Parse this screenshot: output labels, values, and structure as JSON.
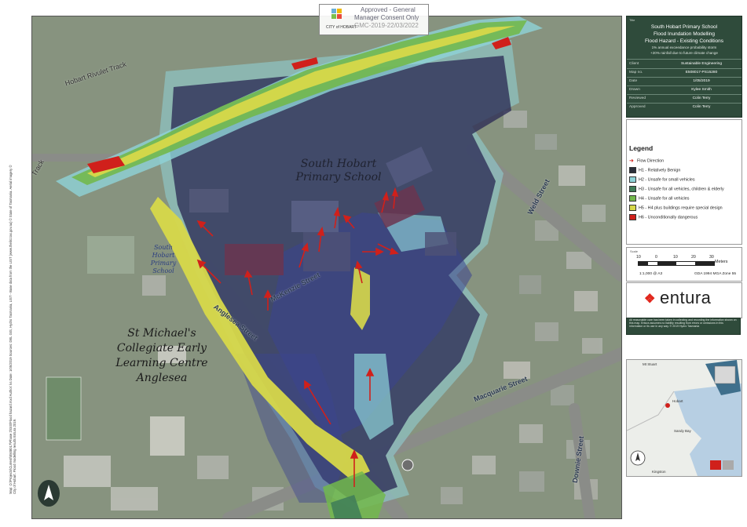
{
  "approval_stamp": {
    "line1": "Approved - General",
    "line2": "Manager Consent Only",
    "line3": "GMC-2019-22/03/2022",
    "logo_text": "CITY of HOBART"
  },
  "title_block": {
    "title_label": "Title",
    "line1": "South Hobart Primary School",
    "line2": "Flood Inundation Modelling",
    "line3": "Flood Hazard - Existing Conditions",
    "line4": "1% annual exceedance probability storm",
    "line5": "+20% rainfall due to future climate change",
    "rows": [
      {
        "key": "Client",
        "value": "Sustainable Engineering"
      },
      {
        "key": "Map no.",
        "value": "E508017-PS15280"
      },
      {
        "key": "Date",
        "value": "1/05/2019"
      },
      {
        "key": "Drawn",
        "value": "Kylee Smith"
      },
      {
        "key": "Reviewed",
        "value": "Colin Terry"
      },
      {
        "key": "Approved",
        "value": "Colin Terry"
      }
    ]
  },
  "legend": {
    "title": "Legend",
    "flow_direction": "Flow Direction",
    "items": [
      {
        "label": "H1 - Relatively Benign",
        "color": "#2b2f3a"
      },
      {
        "label": "H2 - Unsafe for small vehicles",
        "color": "#8fd3d8"
      },
      {
        "label": "H3 - Unsafe for all vehicles, children & elderly",
        "color": "#3f7d58"
      },
      {
        "label": "H4 - Unsafe for all vehicles",
        "color": "#72b84c"
      },
      {
        "label": "H5 - H4 plus buildings require special design",
        "color": "#d7d84a"
      },
      {
        "label": "H6 - Unconditionally dangerous",
        "color": "#d0201b"
      }
    ]
  },
  "scale": {
    "label": "Scale",
    "ticks": [
      "10",
      "0",
      "10",
      "20",
      "30"
    ],
    "units": "Meters",
    "ratio": "1:1,000  @ A3",
    "projection": "GDA 1994 MGA Zone 55"
  },
  "brand": {
    "name": "entura"
  },
  "disclaimer": "All reasonable care has been taken in collecting and recording the information shown on this map. Entura assumes no liability resulting from errors or omissions in this information or its use in any way. © 2019 Hydro Tasmania",
  "map_labels": {
    "school": "South Hobart Primary School",
    "school_small": "South Hobart Primary School",
    "collegiate": "St Michael's Collegiate Early Learning Centre Anglesea",
    "rivulet_track": "Hobart Rivulet Track",
    "track_left": "Track",
    "weld_street": "Weld Street",
    "mckenzie_street": "McKenzie Street",
    "anglesea_street": "Anglesea Street",
    "macquarie_street": "Macquarie Street",
    "downie_street": "Downie Street"
  },
  "location_map": {
    "labels": [
      "Mt Stuart",
      "Hobart",
      "Sandy Bay",
      "Kingston"
    ]
  },
  "side_note": "Map: O:\\Projects\\Current\\E508017\\Phase 2\\GIS\\Flood hazard.mxd  Author: ks  Date: 1/05/2019  Sources: DEL GIS, Hydro Tasmania, LIST - Base data from the LIST (www.thelist.tas.gov.au) © State of Tasmania. Aerial imagery © City of Hobart. Flood modelling results Entura 2019."
}
